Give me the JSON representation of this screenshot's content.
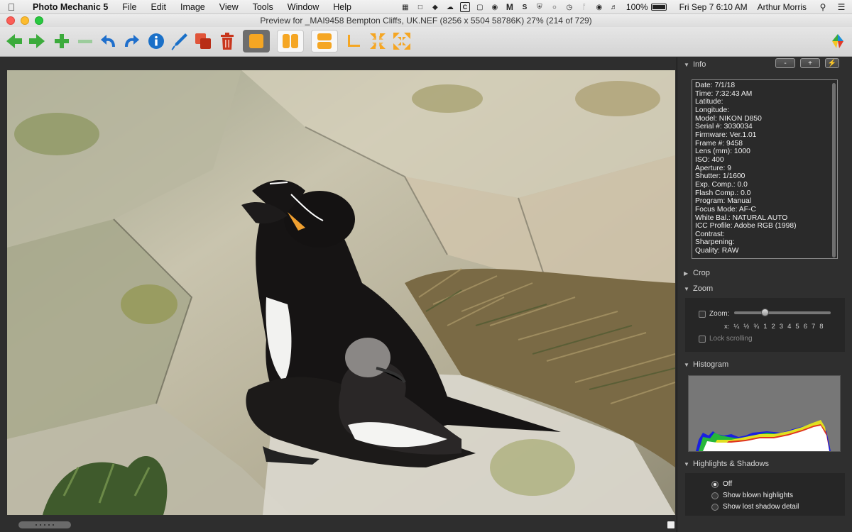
{
  "menubar": {
    "app_name": "Photo Mechanic 5",
    "menus": [
      "File",
      "Edit",
      "Image",
      "View",
      "Tools",
      "Window",
      "Help"
    ],
    "status": {
      "battery_percent": "100%",
      "datetime": "Fri Sep 7  6:10 AM",
      "user": "Arthur Morris"
    }
  },
  "window": {
    "title": "Preview for _MAI9458 Bempton Cliffs, UK.NEF (8256 x 5504 58786K) 27% (214 of 729)"
  },
  "toolbar": {
    "buttons": [
      "previous-arrow-icon",
      "next-arrow-icon",
      "zoom-in-icon",
      "zoom-out-icon",
      "rotate-left-icon",
      "rotate-right-icon",
      "info-icon",
      "edit-pen-icon",
      "copy-icon",
      "trash-icon",
      "single-view-icon",
      "side-by-side-icon",
      "stacked-view-icon",
      "crop-corner-icon",
      "fit-shrink-icon",
      "fit-expand-icon",
      "app-logo-icon"
    ]
  },
  "panel": {
    "info": {
      "title": "Info",
      "btn_minus": "-",
      "btn_plus": "+",
      "lines": [
        "Date: 7/1/18",
        "Time: 7:32:43 AM",
        "Latitude:",
        "Longitude:",
        "Model: NIKON D850",
        "Serial #: 3030034",
        "Firmware: Ver.1.01",
        "Frame #: 9458",
        "Lens (mm): 1000",
        "ISO: 400",
        "Aperture: 9",
        "Shutter: 1/1600",
        "Exp. Comp.: 0.0",
        "Flash Comp.: 0.0",
        "Program: Manual",
        "Focus Mode: AF-C",
        "White Bal.: NATURAL AUTO",
        "ICC Profile: Adobe RGB (1998)",
        "Contrast:",
        "Sharpening:",
        "Quality: RAW"
      ]
    },
    "crop": {
      "title": "Crop"
    },
    "zoom": {
      "title": "Zoom",
      "zoom_label": "Zoom:",
      "scale_prefix": "x:",
      "scale": [
        "¼",
        "½",
        "¾",
        "1",
        "2",
        "3",
        "4",
        "5",
        "6",
        "7",
        "8"
      ],
      "lock_label": "Lock scrolling",
      "slider_value": 0.3
    },
    "histogram": {
      "title": "Histogram"
    },
    "highlights": {
      "title": "Highlights & Shadows",
      "options": [
        "Off",
        "Show blown highlights",
        "Show lost shadow detail"
      ],
      "selected": 0
    }
  },
  "colors": {
    "arrow_green": "#3cab3c",
    "plus_green": "#3cab3c",
    "rotate_blue": "#1f6fcc",
    "info_blue": "#1a70c8",
    "red_copy": "#c8351c",
    "orange_view": "#f5a623",
    "panel_bg": "#2f2f2f"
  }
}
